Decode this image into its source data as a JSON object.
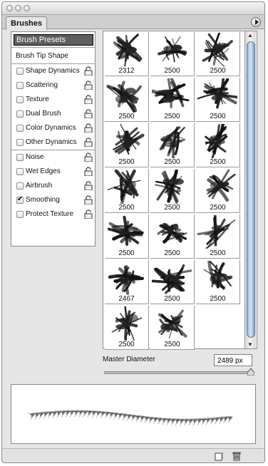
{
  "panel": {
    "tab_label": "Brushes",
    "menu_icon": "flyout-menu-icon"
  },
  "options": {
    "presets_label": "Brush Presets",
    "tip_shape_label": "Brush Tip Shape",
    "group1": [
      {
        "label": "Shape Dynamics",
        "checked": false
      },
      {
        "label": "Scattering",
        "checked": false
      },
      {
        "label": "Texture",
        "checked": false
      },
      {
        "label": "Dual Brush",
        "checked": false
      },
      {
        "label": "Color Dynamics",
        "checked": false
      },
      {
        "label": "Other Dynamics",
        "checked": false
      }
    ],
    "group2": [
      {
        "label": "Noise",
        "checked": false
      },
      {
        "label": "Wet Edges",
        "checked": false
      },
      {
        "label": "Airbrush",
        "checked": false
      },
      {
        "label": "Smoothing",
        "checked": true
      },
      {
        "label": "Protect Texture",
        "checked": false
      }
    ]
  },
  "brushes": [
    {
      "size": "2312"
    },
    {
      "size": "2500"
    },
    {
      "size": "2500"
    },
    {
      "size": "2500"
    },
    {
      "size": "2500"
    },
    {
      "size": "2500"
    },
    {
      "size": "2500"
    },
    {
      "size": "2500"
    },
    {
      "size": "2500"
    },
    {
      "size": "2500"
    },
    {
      "size": "2500"
    },
    {
      "size": "2500"
    },
    {
      "size": "2500"
    },
    {
      "size": "2500"
    },
    {
      "size": "2500"
    },
    {
      "size": "2467"
    },
    {
      "size": "2500"
    },
    {
      "size": "2500"
    },
    {
      "size": "2500"
    },
    {
      "size": "2500"
    }
  ],
  "master_diameter": {
    "label": "Master Diameter",
    "value": "2489 px",
    "fraction": 0.99
  },
  "bottom_bar": {
    "icons": [
      "new-preset-icon",
      "trash-icon"
    ]
  }
}
